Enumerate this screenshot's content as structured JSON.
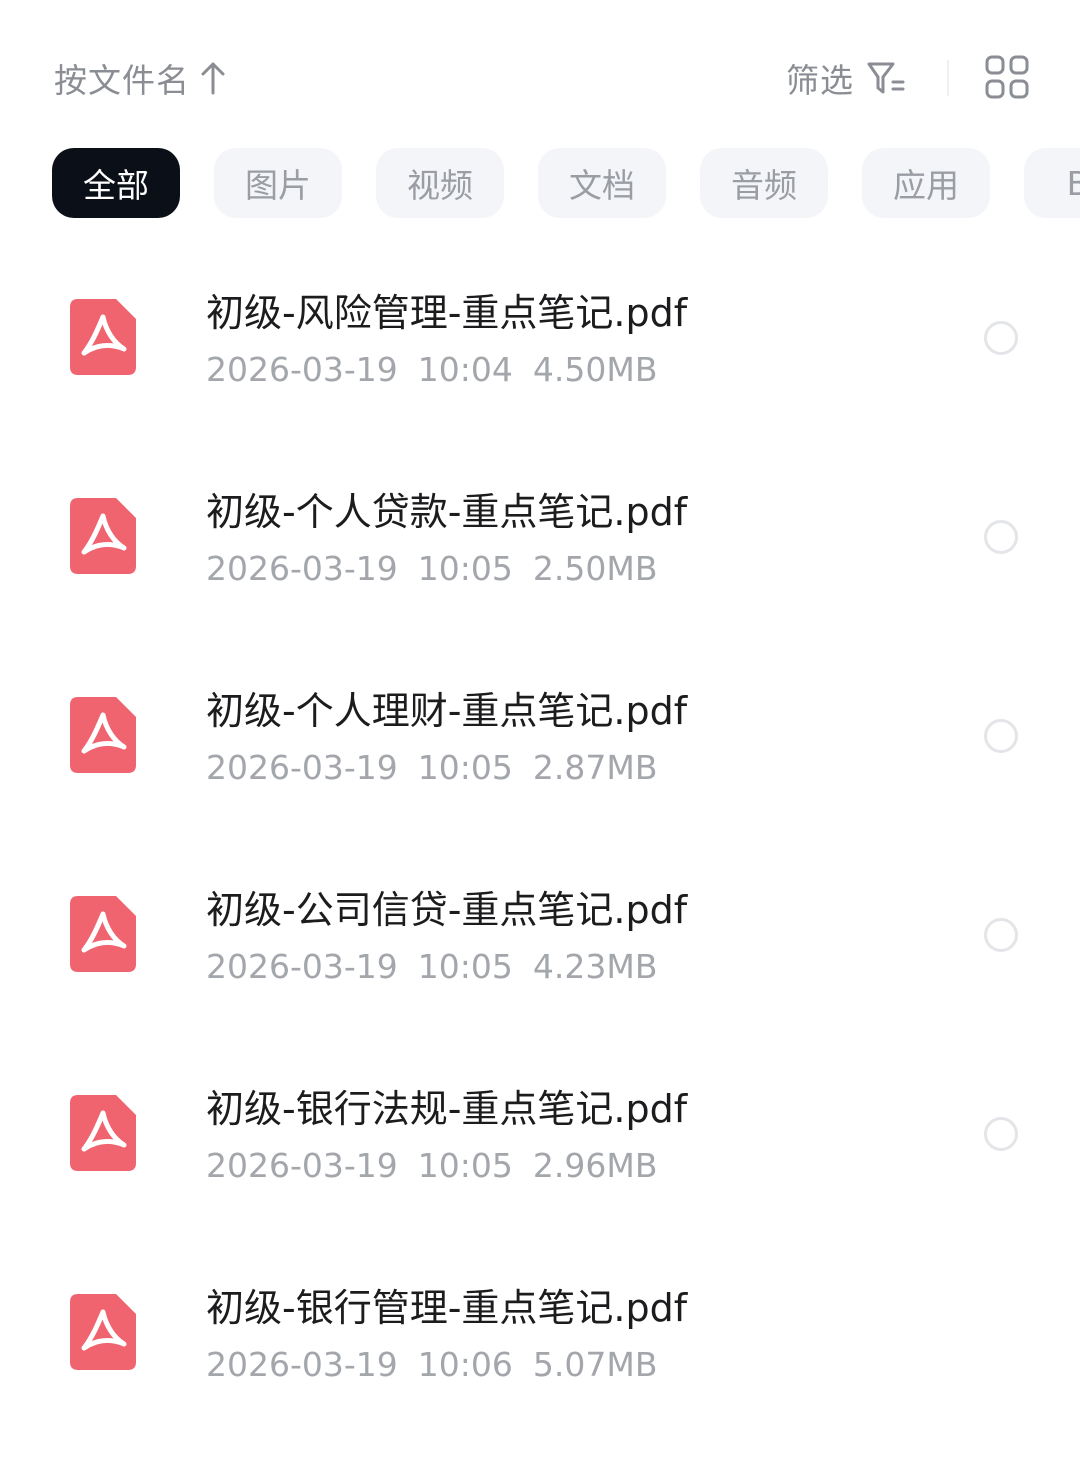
{
  "sort": {
    "label": "按文件名",
    "icon": "arrow-up-icon"
  },
  "filter": {
    "label": "筛选",
    "icon": "filter-icon"
  },
  "view_toggle": {
    "icon": "grid-view-icon"
  },
  "tabs": [
    {
      "label": "全部",
      "active": true
    },
    {
      "label": "图片",
      "active": false
    },
    {
      "label": "视频",
      "active": false
    },
    {
      "label": "文档",
      "active": false
    },
    {
      "label": "音频",
      "active": false
    },
    {
      "label": "应用",
      "active": false
    },
    {
      "label": "BT",
      "active": false
    }
  ],
  "files": [
    {
      "name": "初级-风险管理-重点笔记.pdf",
      "date": "2026-03-19",
      "time": "10:04",
      "size": "4.50MB",
      "icon": "pdf-icon"
    },
    {
      "name": "初级-个人贷款-重点笔记.pdf",
      "date": "2026-03-19",
      "time": "10:05",
      "size": "2.50MB",
      "icon": "pdf-icon"
    },
    {
      "name": "初级-个人理财-重点笔记.pdf",
      "date": "2026-03-19",
      "time": "10:05",
      "size": "2.87MB",
      "icon": "pdf-icon"
    },
    {
      "name": "初级-公司信贷-重点笔记.pdf",
      "date": "2026-03-19",
      "time": "10:05",
      "size": "4.23MB",
      "icon": "pdf-icon"
    },
    {
      "name": "初级-银行法规-重点笔记.pdf",
      "date": "2026-03-19",
      "time": "10:05",
      "size": "2.96MB",
      "icon": "pdf-icon"
    },
    {
      "name": "初级-银行管理-重点笔记.pdf",
      "date": "2026-03-19",
      "time": "10:06",
      "size": "5.07MB",
      "icon": "pdf-icon"
    }
  ],
  "colors": {
    "accent_dark": "#0b0f17",
    "pdf_red": "#f06470",
    "muted_text": "#a3a6ab"
  }
}
